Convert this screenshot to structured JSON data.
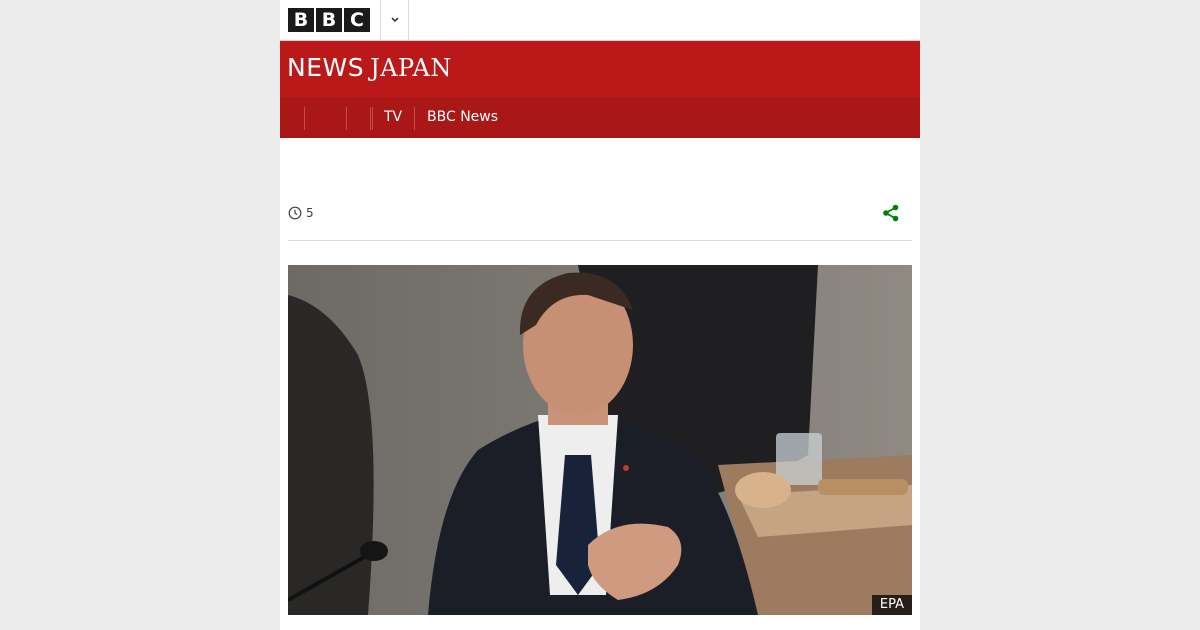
{
  "header": {
    "logo_letters": [
      "B",
      "B",
      "C"
    ],
    "menu_icon": "chevron-down-icon"
  },
  "masthead": {
    "brand_news": "NEWS",
    "brand_japan": "JAPAN",
    "color": "#bb1919"
  },
  "nav": {
    "items": [
      {
        "label": ""
      },
      {
        "label": ""
      },
      {
        "label": ""
      },
      {
        "label": "TV"
      },
      {
        "label": "BBC News"
      }
    ]
  },
  "article": {
    "read_time_icon": "clock-icon",
    "read_time_value": "5",
    "share_icon": "share-icon",
    "share_color": "#008000",
    "image_credit": "EPA"
  }
}
